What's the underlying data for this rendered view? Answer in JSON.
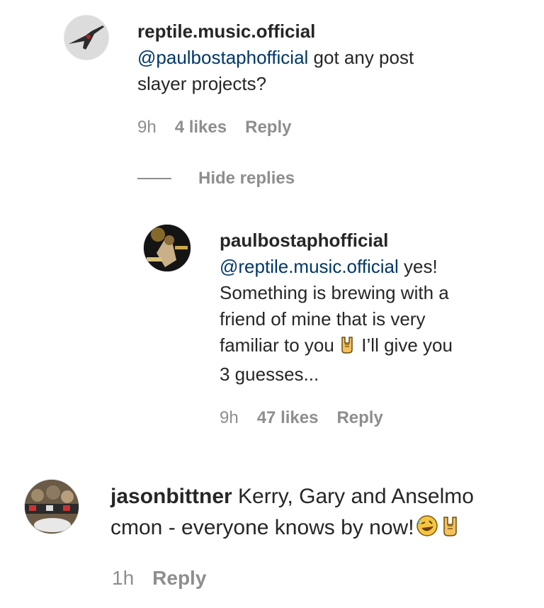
{
  "comments": [
    {
      "username": "reptile.music.official",
      "mention": "@paulbostaphofficial",
      "text_line1": " got any post",
      "text_line2": "slayer projects?",
      "time": "9h",
      "likes": "4 likes",
      "reply_label": "Reply",
      "hide_replies_label": "Hide replies"
    },
    {
      "username": "paulbostaphofficial",
      "mention": "@reptile.music.official",
      "text_line1": " yes!",
      "text_line2": "Something is brewing with a",
      "text_line3": "friend of mine that is very",
      "text_line4a": "familiar to you ",
      "text_line4b": " I’ll give you",
      "text_line5": "3 guesses...",
      "time": "9h",
      "likes": "47 likes",
      "reply_label": "Reply"
    },
    {
      "username": "jasonbittner",
      "text_line1": " Kerry, Gary and Anselmo",
      "text_line2": "cmon - everyone knows by now!",
      "time": "1h",
      "reply_label": "Reply"
    }
  ],
  "icons": {
    "rock_hand": "rock-hand-emoji",
    "laughing": "rolling-laughing-emoji",
    "avatar1": "guitar-avatar",
    "avatar2": "drummer-avatar",
    "avatar3": "band-avatar"
  },
  "colors": {
    "mention": "#00376b",
    "meta": "#8e8e8e",
    "text": "#262626"
  }
}
